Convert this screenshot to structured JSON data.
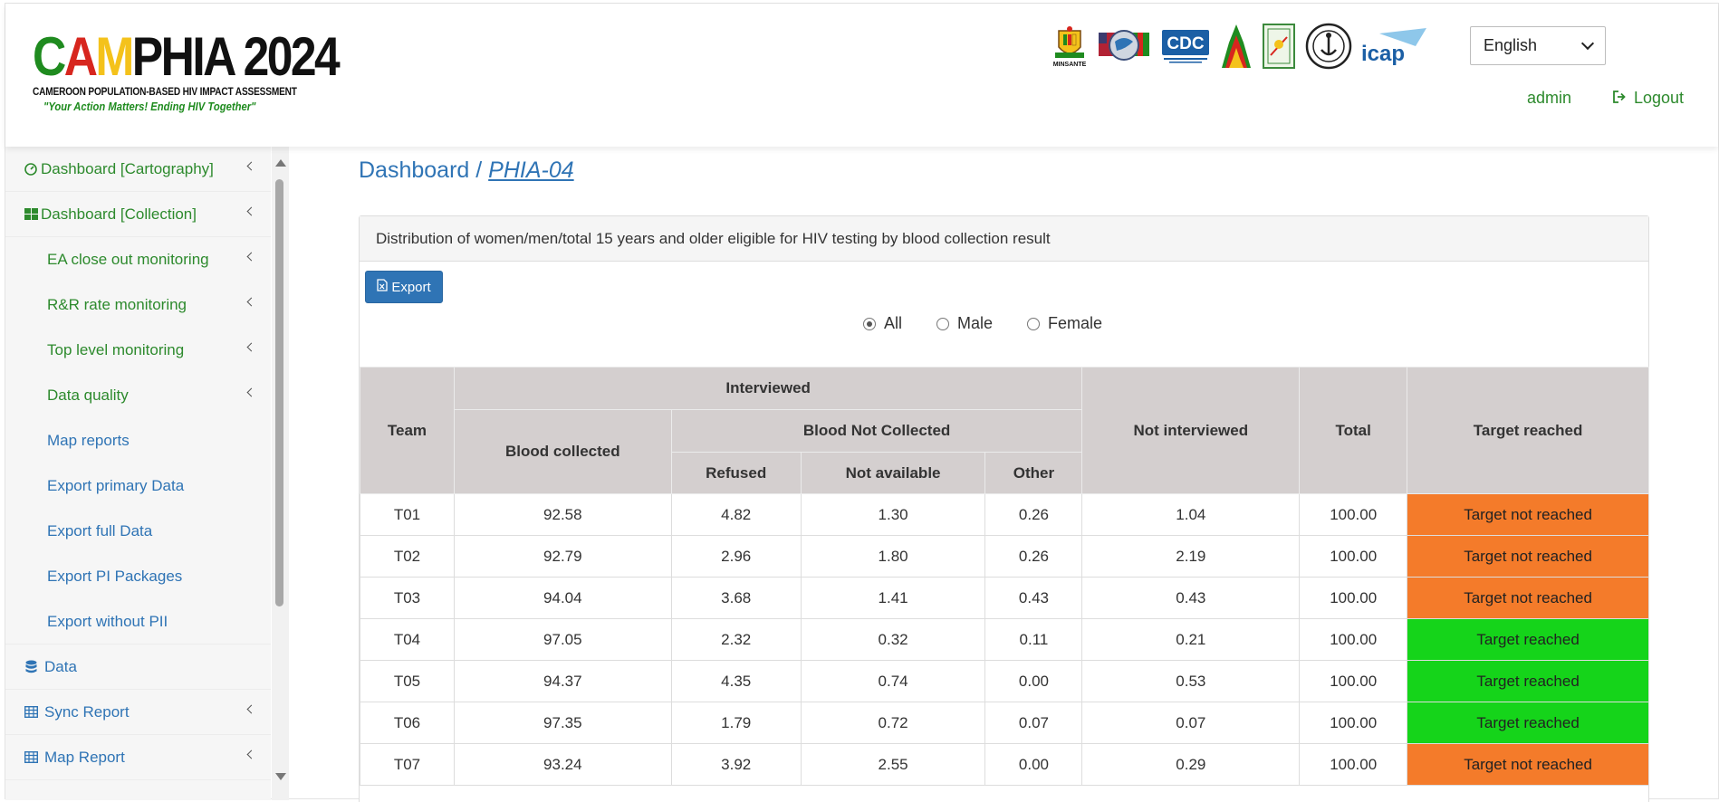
{
  "header": {
    "logo": {
      "letters": [
        {
          "char": "C",
          "color": "#1f8b1f"
        },
        {
          "char": "A",
          "color": "#d7261e"
        },
        {
          "char": "M",
          "color": "#f4c21b"
        },
        {
          "char": "PHIA 2024",
          "color": "#111111"
        }
      ],
      "subtitle": "CAMEROON POPULATION-BASED HIV IMPACT ASSESSMENT",
      "tagline": "\"Your Action Matters! Ending HIV Together\""
    },
    "partners": [
      {
        "icon": "minsante-coat-of-arms-icon",
        "caption": "MINSANTE"
      },
      {
        "icon": "pepfar-flags-globe-icon"
      },
      {
        "icon": "cdc-logo-icon",
        "text": "CDC"
      },
      {
        "icon": "cameroon-map-flag-icon"
      },
      {
        "icon": "green-document-logo-icon"
      },
      {
        "icon": "circular-seal-icon"
      },
      {
        "icon": "icap-logo-icon",
        "text": "icap"
      }
    ],
    "language": "English",
    "user": "admin",
    "logout_label": "Logout",
    "accent_green": "#2d8a2d",
    "link_blue": "#2f74b5"
  },
  "sidebar": {
    "items": [
      {
        "label": "Dashboard [Cartography]",
        "icon": "dashboard-gauge-icon",
        "level": "top",
        "color": "green",
        "chevron": true
      },
      {
        "label": "Dashboard [Collection]",
        "icon": "grid-squares-icon",
        "level": "top",
        "color": "green",
        "chevron": true
      },
      {
        "label": "EA close out monitoring",
        "level": "sub",
        "color": "green",
        "chevron": true
      },
      {
        "label": "R&R rate monitoring",
        "level": "sub",
        "color": "green",
        "chevron": true
      },
      {
        "label": "Top level monitoring",
        "level": "sub",
        "color": "green",
        "chevron": true
      },
      {
        "label": "Data quality",
        "level": "sub",
        "color": "green",
        "chevron": true
      },
      {
        "label": "Map reports",
        "level": "sub",
        "color": "blue",
        "chevron": false
      },
      {
        "label": "Export primary Data",
        "level": "sub",
        "color": "blue",
        "chevron": false
      },
      {
        "label": "Export full Data",
        "level": "sub",
        "color": "blue",
        "chevron": false
      },
      {
        "label": "Export PI Packages",
        "level": "sub",
        "color": "blue",
        "chevron": false
      },
      {
        "label": "Export without PII",
        "level": "sub",
        "color": "blue",
        "chevron": false
      },
      {
        "label": "Data",
        "icon": "database-icon",
        "level": "top",
        "color": "blue",
        "chevron": false
      },
      {
        "label": "Sync Report",
        "icon": "table-icon",
        "level": "top",
        "color": "blue",
        "chevron": true
      },
      {
        "label": "Map Report",
        "icon": "table-icon",
        "level": "top",
        "color": "blue",
        "chevron": true
      }
    ]
  },
  "main": {
    "breadcrumb": {
      "root": "Dashboard",
      "separator": " / ",
      "current": "PHIA-04"
    },
    "panel_title": "Distribution of women/men/total 15 years and older eligible for HIV testing by blood collection result",
    "export_label": "Export",
    "filters": [
      {
        "label": "All",
        "checked": true
      },
      {
        "label": "Male",
        "checked": false
      },
      {
        "label": "Female",
        "checked": false
      }
    ],
    "table": {
      "headers": {
        "team": "Team",
        "interviewed": "Interviewed",
        "blood_collected": "Blood collected",
        "blood_not_collected": "Blood Not Collected",
        "refused": "Refused",
        "not_available": "Not available",
        "other": "Other",
        "not_interviewed": "Not interviewed",
        "total": "Total",
        "target": "Target reached"
      },
      "rows": [
        {
          "team": "T01",
          "blood_collected": "92.58",
          "refused": "4.82",
          "not_available": "1.30",
          "other": "0.26",
          "not_interviewed": "1.04",
          "total": "100.00",
          "target": "Target not reached",
          "status": "notreached"
        },
        {
          "team": "T02",
          "blood_collected": "92.79",
          "refused": "2.96",
          "not_available": "1.80",
          "other": "0.26",
          "not_interviewed": "2.19",
          "total": "100.00",
          "target": "Target not reached",
          "status": "notreached"
        },
        {
          "team": "T03",
          "blood_collected": "94.04",
          "refused": "3.68",
          "not_available": "1.41",
          "other": "0.43",
          "not_interviewed": "0.43",
          "total": "100.00",
          "target": "Target not reached",
          "status": "notreached"
        },
        {
          "team": "T04",
          "blood_collected": "97.05",
          "refused": "2.32",
          "not_available": "0.32",
          "other": "0.11",
          "not_interviewed": "0.21",
          "total": "100.00",
          "target": "Target reached",
          "status": "reached"
        },
        {
          "team": "T05",
          "blood_collected": "94.37",
          "refused": "4.35",
          "not_available": "0.74",
          "other": "0.00",
          "not_interviewed": "0.53",
          "total": "100.00",
          "target": "Target reached",
          "status": "reached"
        },
        {
          "team": "T06",
          "blood_collected": "97.35",
          "refused": "1.79",
          "not_available": "0.72",
          "other": "0.07",
          "not_interviewed": "0.07",
          "total": "100.00",
          "target": "Target reached",
          "status": "reached"
        },
        {
          "team": "T07",
          "blood_collected": "93.24",
          "refused": "3.92",
          "not_available": "2.55",
          "other": "0.00",
          "not_interviewed": "0.29",
          "total": "100.00",
          "target": "Target not reached",
          "status": "notreached"
        }
      ],
      "status_colors": {
        "notreached": "#f47b2a",
        "reached": "#15d41a"
      }
    }
  }
}
